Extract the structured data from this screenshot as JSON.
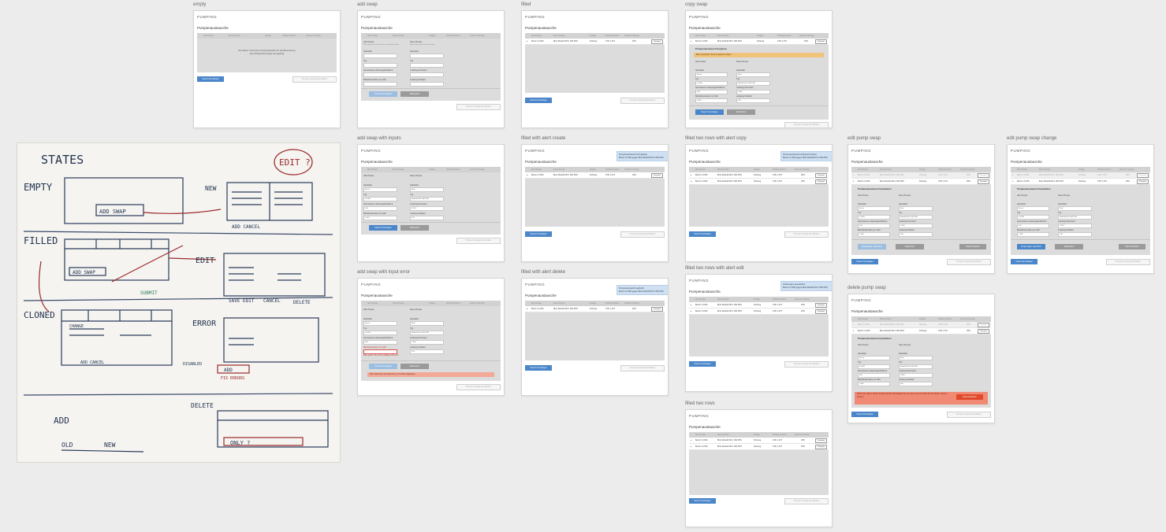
{
  "app": {
    "brand": "PUMPING",
    "page_title": "Pumpenaustausche"
  },
  "columns": [
    "Alte Pumpe",
    "Neue Pumpe",
    "Anlage",
    "Förderprovision",
    "Anteil im Vertrag"
  ],
  "table_row": {
    "old": "Bosch LS 800",
    "new": "Bind Modulift 80 K 060 PN6",
    "plant": "Kühlung",
    "fee": "CHF 1,337",
    "share": "25%",
    "action": "Ersetzen"
  },
  "buttons": {
    "add_swap": "Tausch hinzufügen",
    "contract_close": "Pumpen-Vertrag abschließen",
    "save_swap": "Tausch hinzufügen",
    "cancel": "Abbrechen",
    "save_changes": "Änderungen speichern",
    "delete_swap": "Tausch löschen"
  },
  "empty_message": "Sie haben noch keine Pumpentausche für die Berechnung des Fördertarifvertrags hinzugefügt",
  "form": {
    "add_title": "Pumpenaustausch hinzufügen",
    "copy_title": "Pumpenaustausch kopieren",
    "edit_title": "Pumpenaustausch bearbeiten",
    "old_pump": "Alte Pumpe",
    "old_pump_hint": "Bitte wählen Sie die alte zu ersetzende Pumpe",
    "new_pump": "Neue Pumpe",
    "new_pump_hint": "Bitte wählen Sie die neue Pumpe",
    "manufacturer": "Hersteller",
    "type": "Typ",
    "measured_power": "Gemessene Leistungsaufnahme",
    "calc_power": "Leistung Nennwert",
    "hours": "Betriebsstunden pro Jahr",
    "existing_hours": "Leistung Sollwert",
    "old_brand_value": "Bosch",
    "old_type_value": "LS 800",
    "new_brand_value": "Bind",
    "new_type_value": "Modulift 80 K 060 PN6",
    "measured_value": "500",
    "power_value": "0.300",
    "hours_value": "1,600",
    "existing_value": "100"
  },
  "copy_banner": "Bitte überprüfen Sie die kopierten Daten",
  "error_field_msg": "Bitte geben Sie einen gültigen Wert ein",
  "error_banner": "Beim Speichern des Tauschs ist ein Fehler aufgetreten",
  "alerts": {
    "create": {
      "title": "Pumpenaustausch hinzugefügt",
      "text": "Bosch LS 800 gegen Bind Modulift 80 K 060 PN6"
    },
    "copy": {
      "title": "Pumpenaustausch erfolgreich kopiert",
      "text": "Bosch LS 800 gegen Bind Modulift 80 K 060 PN6"
    },
    "edit": {
      "title": "Änderungen gespeichert",
      "text": "Bosch LS 800 gegen Bind Modulift 80 K 060 PN6"
    },
    "delete": {
      "title": "Pumpenaustausch gelöscht",
      "text": "Bosch LS 800 gegen Bind Modulift 80 K 060 PN6"
    }
  },
  "delete_warning": "Wollen Sie diesen Tausch wirklich löschen? Bestätigen Sie mit einem erneuten Klick auf den Button „Tausch löschen“",
  "artboards": {
    "empty": "empty",
    "add_swap": "add swap",
    "filled": "filled",
    "copy_swap": "copy swap",
    "add_swap_with_inputs": "add swap with inputs",
    "filled_with_alert_create": "filled with alert create",
    "filled_two_rows_with_alert_copy": "filled two rows with alert copy",
    "edit_pump_swap": "edit pump swap",
    "edit_pump_swap_change": "edit pump swap change",
    "add_swap_with_input_error": "add swap with input error",
    "filled_with_alert_delete": "filled with alert delete",
    "filled_two_rows_with_alert_edit": "filled two rows with alert edit",
    "delete_pump_swap": "delete pump swap",
    "filled_two_rows": "filled two rows"
  },
  "whiteboard": {
    "title": "STATES",
    "edit_circle": "EDIT ?",
    "empty": "EMPTY",
    "filled": "FILLED",
    "cloned": "CLONED",
    "add": "ADD",
    "new": "NEW",
    "edit": "EDIT",
    "error": "ERROR",
    "delete": "DELETE",
    "add_swap": "ADD SWAP",
    "add_cancel": "ADD CANCEL",
    "submit": "SUBMIT",
    "save_edit": "SAVE EDIT",
    "cancel": "CANCEL",
    "delete_lower": "DELETE",
    "old": "OLD",
    "only": "ONLY ?",
    "disabled": "DISABLED",
    "add_short": "ADD",
    "fix_errors": "FIX ERRORS",
    "change": "CHANGE"
  }
}
